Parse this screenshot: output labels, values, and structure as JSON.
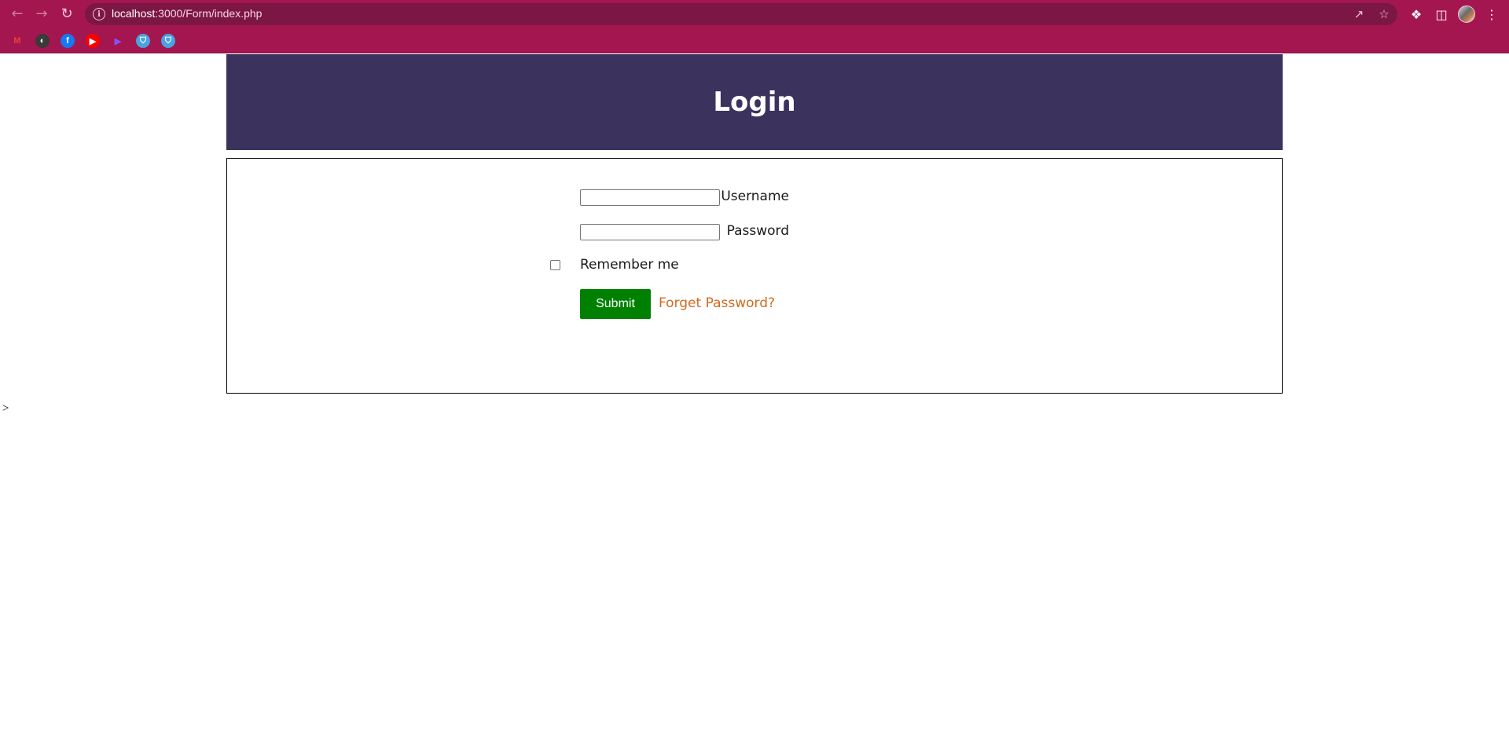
{
  "browser": {
    "url_host": "localhost",
    "url_path": ":3000/Form/index.php",
    "accent_color": "#a4164f",
    "bookmarks": [
      {
        "name": "gmail",
        "glyph": "M",
        "color": "#ea4335",
        "bg": "transparent"
      },
      {
        "name": "globe",
        "glyph": "◐",
        "color": "#ffffff",
        "bg": "#3a3a3a"
      },
      {
        "name": "facebook",
        "glyph": "f",
        "color": "#ffffff",
        "bg": "#1877f2"
      },
      {
        "name": "youtube",
        "glyph": "▶",
        "color": "#ffffff",
        "bg": "#ff0000"
      },
      {
        "name": "play",
        "glyph": "▶",
        "color": "#8a4fff",
        "bg": "transparent"
      },
      {
        "name": "shield-1",
        "glyph": "⛉",
        "color": "#ffffff",
        "bg": "#4aa3df"
      },
      {
        "name": "shield-2",
        "glyph": "⛉",
        "color": "#ffffff",
        "bg": "#4aa3df"
      }
    ]
  },
  "header": {
    "title": "Login",
    "bg_color": "#3c325e"
  },
  "form": {
    "username_label": "Username",
    "username_value": "",
    "password_label": "Password",
    "password_value": "",
    "remember_label": "Remember me",
    "remember_checked": false,
    "submit_label": "Submit",
    "submit_color": "#008000",
    "forgot_label": "Forget Password?",
    "forgot_color": "#d2691e"
  },
  "stray_text": ">"
}
